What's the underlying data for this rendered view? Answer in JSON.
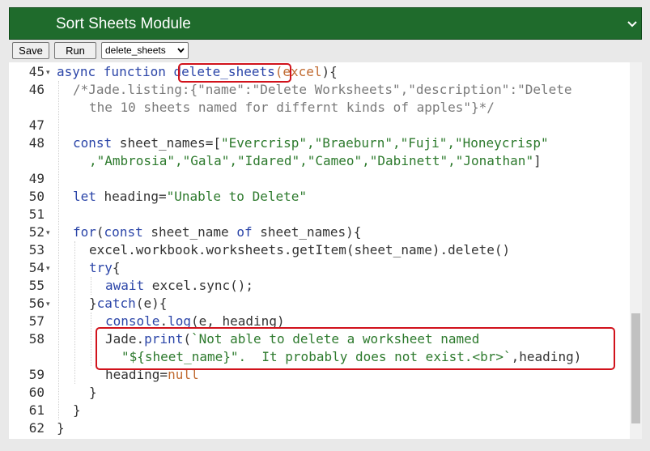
{
  "header": {
    "title": "Sort Sheets Module",
    "chevron_icon": "chevron-down-icon"
  },
  "toolbar": {
    "save_label": "Save",
    "run_label": "Run",
    "module_select": {
      "selected": "delete_sheets",
      "icon": "chevron-down-icon"
    }
  },
  "colors": {
    "header_bg": "#1f6b2c",
    "keyword": "#2b45a8",
    "string": "#2d7a2d",
    "comment": "#7a7a7a",
    "parameter": "#c06a30",
    "highlight_border": "#d1121b"
  },
  "editor": {
    "line_numbers": [
      "45",
      "46",
      "",
      "47",
      "48",
      "",
      "49",
      "50",
      "51",
      "52",
      "53",
      "54",
      "55",
      "56",
      "57",
      "58",
      "",
      "59",
      "60",
      "61",
      "62"
    ],
    "folded_lines": [
      "45",
      "52",
      "54",
      "56"
    ],
    "code": {
      "l45": {
        "kw1": "async function ",
        "name": "delete_sheets",
        "paren_open": "(",
        "param": "excel",
        "rest": "){"
      },
      "l46a": "/*Jade.listing:{\"name\":\"Delete Worksheets\",\"description\":\"Delete",
      "l46b": "the 10 sheets named for differnt kinds of apples\"}*/",
      "l48a": {
        "kw": "const",
        "ident": " sheet_names=[",
        "strs": "\"Evercrisp\",\"Braeburn\",\"Fuji\",\"Honeycrisp\""
      },
      "l48b": {
        "strs": ",\"Ambrosia\",\"Gala\",\"Idared\",\"Cameo\",\"Dabinett\",\"Jonathan\"",
        "close": "]"
      },
      "l50": {
        "kw": "let",
        "ident": " heading=",
        "str": "\"Unable to Delete\""
      },
      "l52": {
        "kw1": "for",
        "p1": "(",
        "kw2": "const",
        "mid": " sheet_name ",
        "kw3": "of",
        "rest": " sheet_names){"
      },
      "l53": "excel.workbook.worksheets.getItem(sheet_name).delete()",
      "l54": {
        "kw": "try",
        "rest": "{"
      },
      "l55": {
        "kw": "await",
        "rest": " excel.sync();"
      },
      "l56": {
        "p": "}",
        "kw": "catch",
        "rest": "(e){"
      },
      "l57": {
        "obj": "console",
        "dot": ".",
        "fn": "log",
        "rest": "(e, heading)"
      },
      "l58a": {
        "obj": "Jade",
        "dot": ".",
        "fn": "print",
        "p": "(",
        "str": "`Not able to delete a worksheet named"
      },
      "l58b": {
        "str": "\"${sheet_name}\".  It probably does not exist.<br>`",
        "rest": ",heading)"
      },
      "l59": {
        "ident": "heading=",
        "kw": "null"
      },
      "l60": "}",
      "l61": "}",
      "l62": "}"
    }
  }
}
